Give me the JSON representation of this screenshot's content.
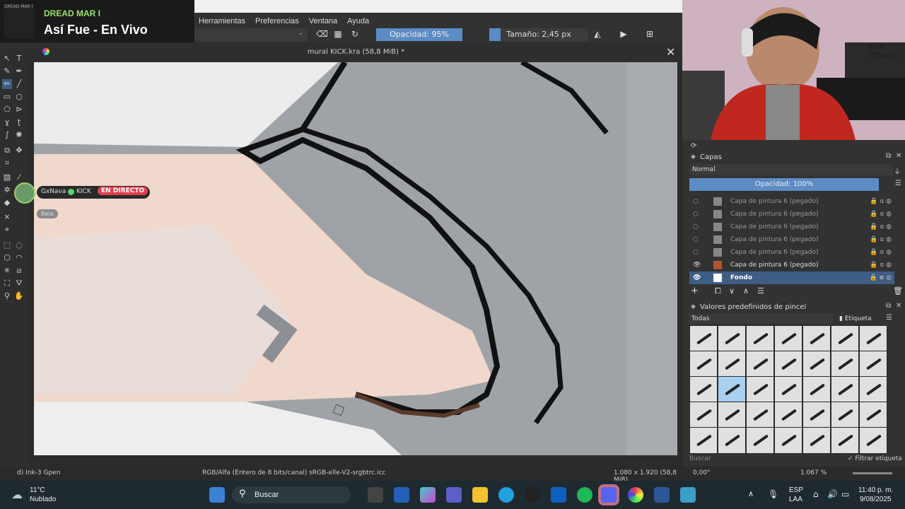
{
  "now_playing": {
    "artist": "DREAD MAR I",
    "song": "Así Fue - En Vivo",
    "art_label": "DREAD MAR I"
  },
  "menu": [
    "Herramientas",
    "Preferencias",
    "Ventana",
    "Ayuda"
  ],
  "toolbar": {
    "opacity": "Opacidad: 95%",
    "size": "Tamaño: 2,45 px"
  },
  "document": {
    "title": "mural KICK.kra (58,8 MiB) *"
  },
  "stream_overlay": {
    "user": "GxNava",
    "platform": "KICK",
    "live": "EN DIRECTO",
    "sub": "Bela"
  },
  "status": {
    "brush": "d) Ink-3 Gpen",
    "color_space": "RGB/Alfa (Entero de 8 bits/canal)  sRGB-elle-V2-srgbtrc.icc",
    "dimensions": "1.080 x 1.920 (58,8 MiB)",
    "rotation": "0,00°",
    "zoom": "1.067 %"
  },
  "webcam": {
    "sign_line1": "KICK",
    "sign_line2": "GXNAVA"
  },
  "layers_docker": {
    "title": "Capas",
    "blend_mode": "Normal",
    "opacity": "Opacidad:  100%",
    "layers": [
      {
        "name": "Capa de pintura 6 (pegado)",
        "visible": false
      },
      {
        "name": "Capa de pintura 6 (pegado)",
        "visible": false
      },
      {
        "name": "Capa de pintura 6 (pegado)",
        "visible": false
      },
      {
        "name": "Capa de pintura 6 (pegado)",
        "visible": false
      },
      {
        "name": "Capa de pintura 6 (pegado)",
        "visible": false
      },
      {
        "name": "Capa de pintura 6 (pegado)",
        "visible": true
      },
      {
        "name": "Fondo",
        "visible": true,
        "active": true
      }
    ]
  },
  "brush_docker": {
    "title": "Valores predefinidos de pincel",
    "filter": "Todas",
    "tag": "Etiqueta",
    "search_placeholder": "Buscar",
    "filter_tag": "Filtrar etiqueta"
  },
  "taskbar": {
    "weather_temp": "11°C",
    "weather_desc": "Nublado",
    "search": "Buscar",
    "lang1": "ESP",
    "lang2": "LAA",
    "time": "11:40 p. m.",
    "date": "9/08/2025"
  },
  "colors": {
    "accent": "#5c8cc5",
    "skin": "#f0d8cc",
    "live": "#e0404e"
  }
}
